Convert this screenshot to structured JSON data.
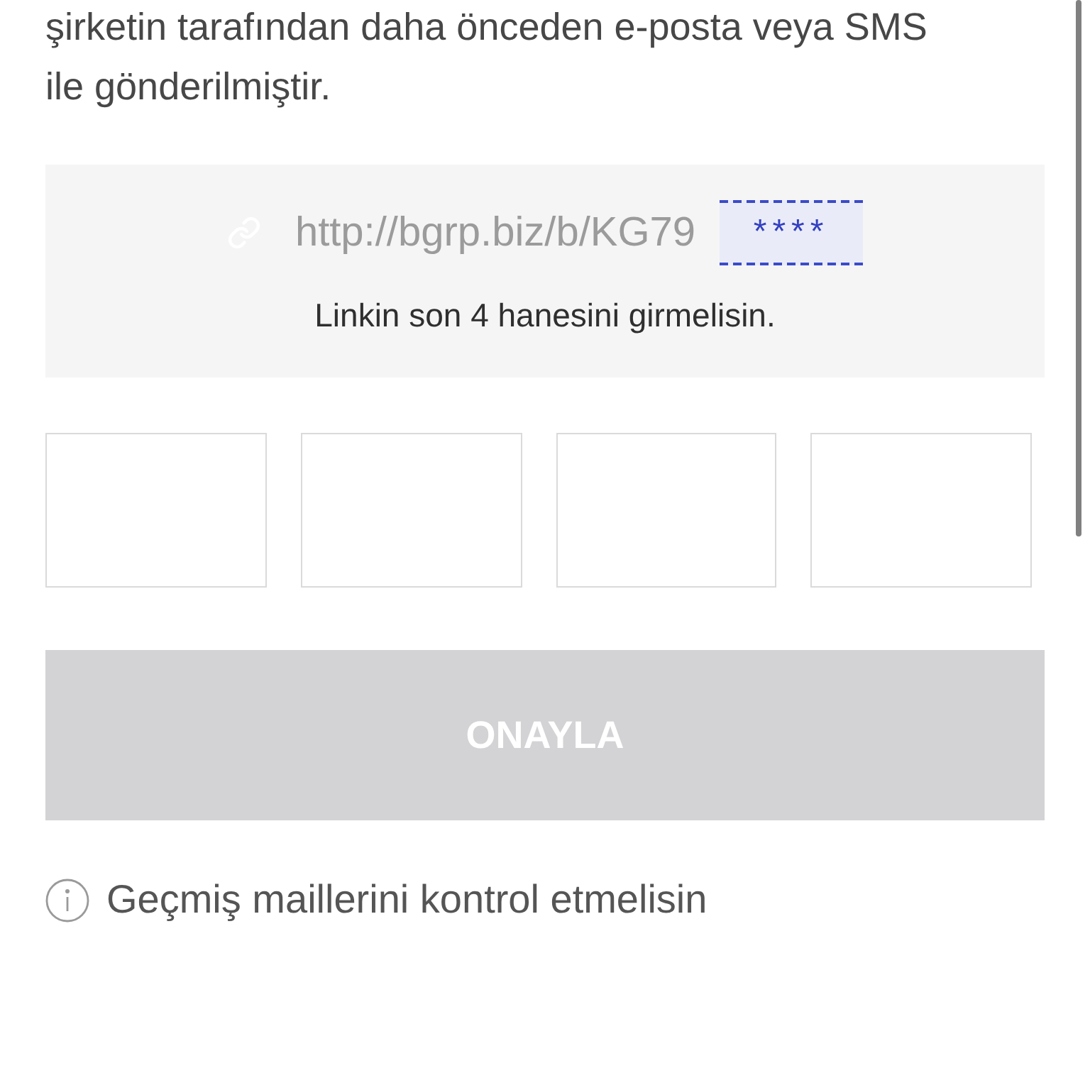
{
  "message": {
    "lines": [
      "şirketin tarafından daha önceden e-posta veya SMS",
      "ile gönderilmiştir."
    ]
  },
  "link_hint": {
    "url": "http://bgrp.biz/b/KG79",
    "masked_suffix": "****",
    "instruction": "Linkin son 4 hanesini girmelisin."
  },
  "confirm_button": {
    "label": "ONAYLA",
    "disabled": true
  },
  "info_note": {
    "text": "Geçmiş maillerini kontrol etmelisin"
  }
}
